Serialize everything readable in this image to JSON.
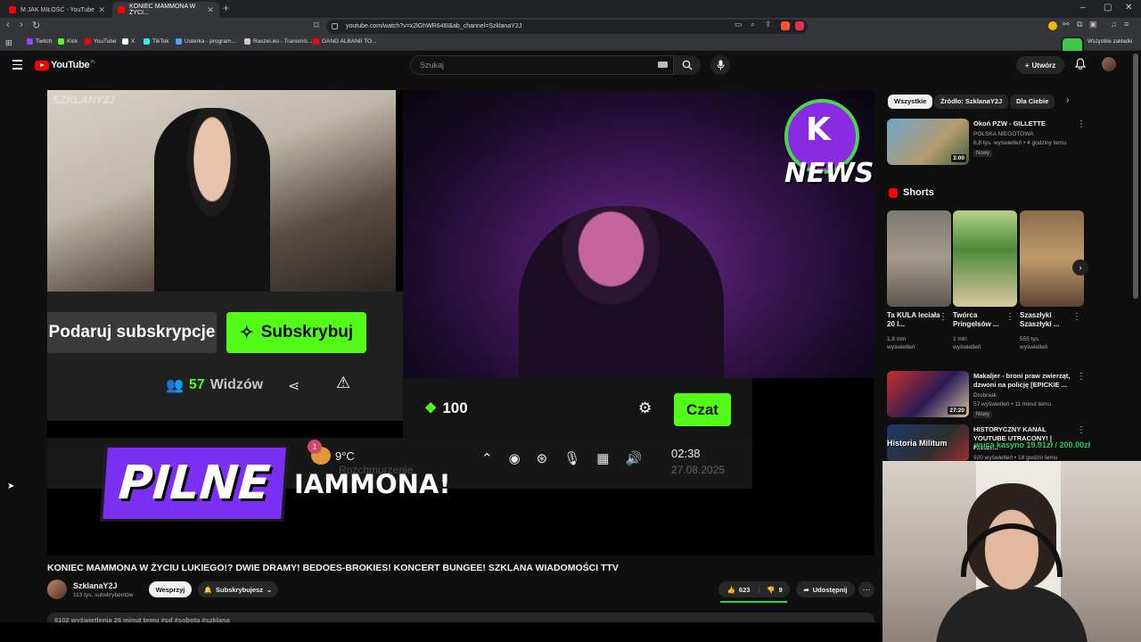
{
  "browser": {
    "tabs": [
      {
        "label": "M JAK MIŁOŚĆ - YouTube"
      },
      {
        "label": "KONIEC MAMMONA W ŻYCI..."
      }
    ],
    "new_tab": "+",
    "window": {
      "min": "–",
      "max": "▢",
      "close": "✕"
    },
    "url": "youtube.com/watch?v=x2lGhWR648I&ab_channel=SzklanaY2J",
    "bookmarks": [
      {
        "label": "Twitch",
        "color": "#9146ff"
      },
      {
        "label": "Kick",
        "color": "#53fc18"
      },
      {
        "label": "YouTube",
        "color": "#ff0000"
      },
      {
        "label": "X",
        "color": "#ffffff"
      },
      {
        "label": "TikTok",
        "color": "#25f4ee"
      },
      {
        "label": "Usterka - program...",
        "color": "#4aa3ff"
      },
      {
        "label": "Raszei.eu - Transmis...",
        "color": "#cccccc"
      },
      {
        "label": "GANG ALBANII TO...",
        "color": "#ff0000"
      }
    ],
    "other_bookmarks": "Wszystkie zakładki"
  },
  "youtube": {
    "logo_text": "YouTube",
    "logo_region": "PL",
    "search_placeholder": "Szukaj",
    "create_label": "Utwórz"
  },
  "video": {
    "watermark": "SZKLANY2J",
    "news_badge": {
      "mark": "K",
      "text": "NEWS"
    },
    "gift_label": "Podaruj subskrypcje",
    "subscribe_label": "Subskrybuj",
    "viewers_count": "57",
    "viewers_label": "Widzów",
    "points": "100",
    "chat_label": "Czat",
    "weather_badge": "1",
    "weather_temp": "9°C",
    "weather_desc": "Rozchmurzenie",
    "clock_time": "02:38",
    "clock_date": "27.08.2025",
    "pilne_label": "PILNE",
    "ticker_text": "IAMMONA!"
  },
  "details": {
    "title": "KONIEC MAMMONA W ŻYCIU LUKIEGO!? DWIE DRAMY! BEDOES-BROKIES! KONCERT BUNGEE! SZKLANA WIADOMOŚCI TTV",
    "channel_name": "SzklanaY2J",
    "channel_subs": "113 tys. subskrybentów",
    "support_label": "Wesprzyj",
    "subscribed_label": "Subskrybujesz",
    "likes": "623",
    "dislikes": "9",
    "like_ratio": 0.985,
    "share_label": "Udostępnij",
    "more_label": "⋯",
    "description_preview": "6102 wyświetlenia  26 minut temu  #sd #sobota #szklana"
  },
  "sidebar": {
    "chips": [
      "Wszystkie",
      "Źródło: SzklanaY2J",
      "Dla Ciebie"
    ],
    "recommended": [
      {
        "title": "Okoń PZW - GILLETTE",
        "channel": "POLSKA NIEGOTOWA",
        "meta": "8,8 tys. wyświetleń • 4 godziny temu",
        "badge": "Nowy",
        "duration": "3:00"
      },
      {
        "title": "Makaljer - broni praw zwierząt, dzwoni na policję [EPICKIE ...",
        "channel": "Drobniak",
        "meta": "57 wyświetleń • 11 minut temu",
        "badge": "Nowy",
        "duration": "27:20"
      },
      {
        "title": "HISTORYCZNY KANAŁ YOUTUBE UTRACONY! | Histor...",
        "channel": "Historia Militum",
        "meta": "920 wyświetleń • 18 godzin temu",
        "badge": "",
        "duration": ""
      }
    ],
    "shorts_title": "Shorts",
    "shorts": [
      {
        "title": "Ta KULA leciała 20 l...",
        "views": "1,8 mln wyświetleń"
      },
      {
        "title": "Twórca Pringelsów ...",
        "views": "1 mln wyświetleń"
      },
      {
        "title": "Szaszłyki Szaszłyki ...",
        "views": "555 tys. wyświetleń"
      }
    ]
  },
  "overlay": {
    "webcam_text": "Historia Militum",
    "donation_text": "wuca kasyno 19.91zł / 200.00zł"
  }
}
